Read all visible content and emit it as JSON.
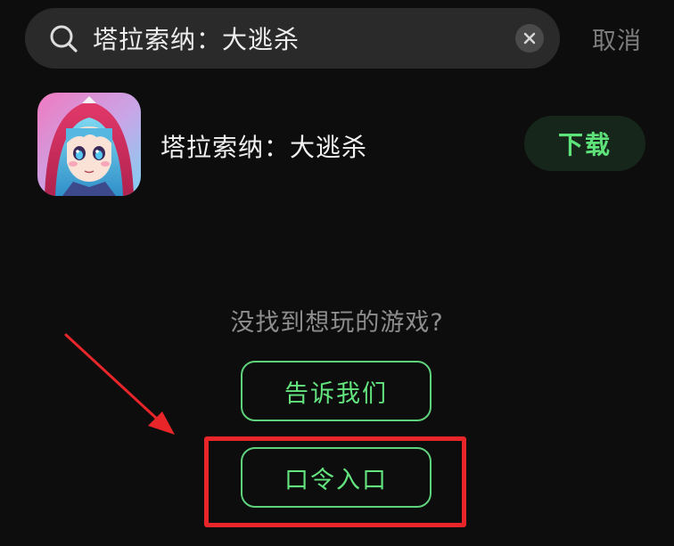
{
  "search": {
    "value": "塔拉索纳：大逃杀",
    "cancel_label": "取消"
  },
  "result": {
    "app_name": "塔拉索纳：大逃杀",
    "download_label": "下载"
  },
  "empty_prompt": {
    "text": "没找到想玩的游戏?",
    "feedback_label": "告诉我们",
    "code_entry_label": "口令入口"
  },
  "icons": {
    "search": "search-icon",
    "clear": "close-icon",
    "app": "app-icon"
  },
  "colors": {
    "accent": "#5ee27a",
    "highlight": "#e8262a",
    "background": "#0d0d0d"
  }
}
